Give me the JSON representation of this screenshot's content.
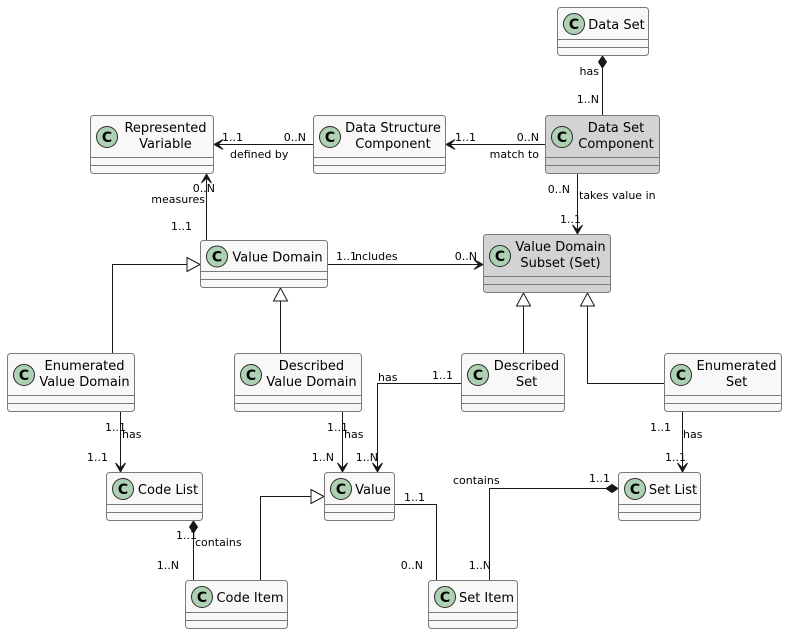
{
  "diagram": {
    "type": "uml-class-diagram",
    "stereotype_glyph": "C",
    "colors": {
      "class_fill": "#f8f8f8",
      "highlight_fill": "#d3d3d3",
      "class_icon": "#add1b2",
      "border": "#7a7a7a",
      "edge": "#181818"
    },
    "classes": [
      {
        "id": "data-set",
        "lines": [
          "Data Set"
        ],
        "highlight": false
      },
      {
        "id": "represented-variable",
        "lines": [
          "Represented",
          "Variable"
        ],
        "highlight": false
      },
      {
        "id": "data-structure-component",
        "lines": [
          "Data Structure",
          "Component"
        ],
        "highlight": false
      },
      {
        "id": "data-set-component",
        "lines": [
          "Data Set",
          "Component"
        ],
        "highlight": true
      },
      {
        "id": "value-domain",
        "lines": [
          "Value Domain"
        ],
        "highlight": false
      },
      {
        "id": "value-domain-subset",
        "lines": [
          "Value Domain",
          "Subset (Set)"
        ],
        "highlight": true
      },
      {
        "id": "enumerated-value-domain",
        "lines": [
          "Enumerated",
          "Value Domain"
        ],
        "highlight": false
      },
      {
        "id": "described-value-domain",
        "lines": [
          "Described",
          "Value Domain"
        ],
        "highlight": false
      },
      {
        "id": "described-set",
        "lines": [
          "Described",
          "Set"
        ],
        "highlight": false
      },
      {
        "id": "enumerated-set",
        "lines": [
          "Enumerated",
          "Set"
        ],
        "highlight": false
      },
      {
        "id": "code-list",
        "lines": [
          "Code List"
        ],
        "highlight": false
      },
      {
        "id": "value",
        "lines": [
          "Value"
        ],
        "highlight": false
      },
      {
        "id": "set-list",
        "lines": [
          "Set List"
        ],
        "highlight": false
      },
      {
        "id": "code-item",
        "lines": [
          "Code Item"
        ],
        "highlight": false
      },
      {
        "id": "set-item",
        "lines": [
          "Set Item"
        ],
        "highlight": false
      }
    ],
    "relations": [
      {
        "id": "ds-has-dsc",
        "kind": "composition",
        "from": "data-set",
        "to": "data-set-component",
        "label": "has",
        "from_mult": "",
        "to_mult": "1..N"
      },
      {
        "id": "dsc-match-dstc",
        "kind": "association",
        "from": "data-set-component",
        "to": "data-structure-component",
        "label": "match to",
        "from_mult": "0..N",
        "to_mult": "1..1"
      },
      {
        "id": "dstc-defined-rv",
        "kind": "association",
        "from": "data-structure-component",
        "to": "represented-variable",
        "label": "defined by",
        "from_mult": "0..N",
        "to_mult": "1..1"
      },
      {
        "id": "dsc-takes-vds",
        "kind": "association",
        "from": "data-set-component",
        "to": "value-domain-subset",
        "label": "takes value in",
        "from_mult": "0..N",
        "to_mult": "1..1"
      },
      {
        "id": "vd-measures-rv",
        "kind": "association",
        "from": "value-domain",
        "to": "represented-variable",
        "label": "measures",
        "from_mult": "1..1",
        "to_mult": "0..N"
      },
      {
        "id": "vd-includes-vds",
        "kind": "association",
        "from": "value-domain",
        "to": "value-domain-subset",
        "label": "includes",
        "from_mult": "1..1",
        "to_mult": "0..N"
      },
      {
        "id": "evd-isa-vd",
        "kind": "generalization",
        "from": "enumerated-value-domain",
        "to": "value-domain"
      },
      {
        "id": "dvd-isa-vd",
        "kind": "generalization",
        "from": "described-value-domain",
        "to": "value-domain"
      },
      {
        "id": "dset-isa-vds",
        "kind": "generalization",
        "from": "described-set",
        "to": "value-domain-subset"
      },
      {
        "id": "eset-isa-vds",
        "kind": "generalization",
        "from": "enumerated-set",
        "to": "value-domain-subset"
      },
      {
        "id": "evd-has-cl",
        "kind": "association",
        "from": "enumerated-value-domain",
        "to": "code-list",
        "label": "has",
        "from_mult": "1..1",
        "to_mult": "1..1"
      },
      {
        "id": "dvd-has-val",
        "kind": "association",
        "from": "described-value-domain",
        "to": "value",
        "label": "has",
        "from_mult": "1..1",
        "to_mult": "1..N"
      },
      {
        "id": "dset-has-val",
        "kind": "association",
        "from": "described-set",
        "to": "value",
        "label": "has",
        "from_mult": "1..1",
        "to_mult": "1..N"
      },
      {
        "id": "eset-has-sl",
        "kind": "association",
        "from": "enumerated-set",
        "to": "set-list",
        "label": "has",
        "from_mult": "1..1",
        "to_mult": "1..1"
      },
      {
        "id": "cl-contains-ci",
        "kind": "composition",
        "from": "code-list",
        "to": "code-item",
        "label": "contains",
        "from_mult": "1..1",
        "to_mult": "1..N"
      },
      {
        "id": "ci-isa-val",
        "kind": "generalization",
        "from": "code-item",
        "to": "value"
      },
      {
        "id": "val-si",
        "kind": "link",
        "from": "value",
        "to": "set-item",
        "label": "",
        "from_mult": "1..1",
        "to_mult": "0..N"
      },
      {
        "id": "sl-contains-si",
        "kind": "composition",
        "from": "set-list",
        "to": "set-item",
        "label": "contains",
        "from_mult": "1..1",
        "to_mult": "1..N"
      }
    ]
  }
}
